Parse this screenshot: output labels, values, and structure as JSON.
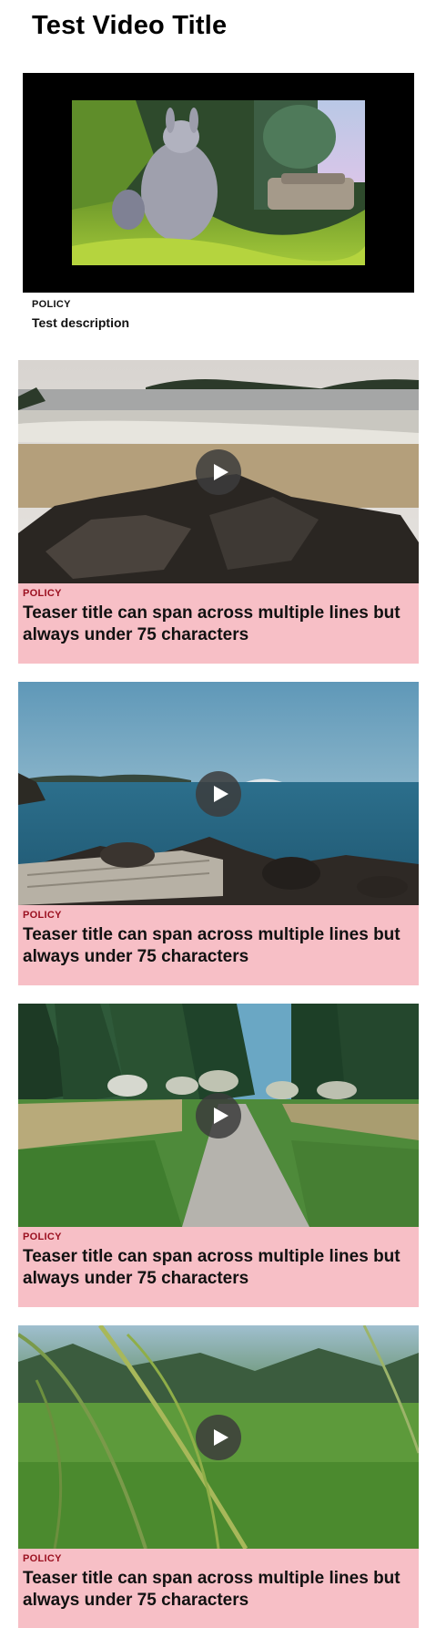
{
  "page": {
    "title": "Test Video Title"
  },
  "featured": {
    "category": "POLICY",
    "description": "Test description"
  },
  "cards": [
    {
      "category": "POLICY",
      "title": "Teaser title can span across multiple lines but always under 75 characters",
      "scene": "beach-rocks"
    },
    {
      "category": "POLICY",
      "title": "Teaser title can span across multiple lines but always under 75 characters",
      "scene": "sea-log"
    },
    {
      "category": "POLICY",
      "title": "Teaser title can span across multiple lines but always under 75 characters",
      "scene": "forest-path"
    },
    {
      "category": "POLICY",
      "title": "Teaser title can span across multiple lines but always under 75 characters",
      "scene": "grass-field"
    }
  ],
  "colors": {
    "card_bg": "#f7bfc6",
    "category_red": "#9b1020",
    "player_bg": "#000000"
  }
}
